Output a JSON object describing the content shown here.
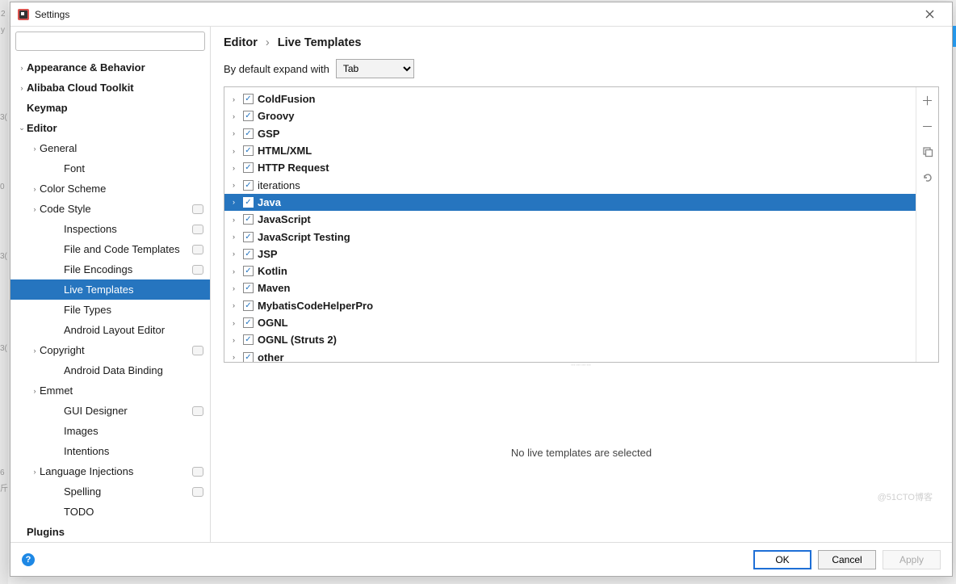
{
  "window": {
    "title": "Settings"
  },
  "search": {
    "placeholder": ""
  },
  "sidebar": [
    {
      "label": "Appearance & Behavior",
      "depth": 0,
      "bold": true,
      "chev": "›"
    },
    {
      "label": "Alibaba Cloud Toolkit",
      "depth": 0,
      "bold": true,
      "chev": "›"
    },
    {
      "label": "Keymap",
      "depth": 0,
      "bold": true
    },
    {
      "label": "Editor",
      "depth": 0,
      "bold": true,
      "chev": "⌄"
    },
    {
      "label": "General",
      "depth": 1,
      "chev": "›"
    },
    {
      "label": "Font",
      "depth": 2
    },
    {
      "label": "Color Scheme",
      "depth": 1,
      "chev": "›"
    },
    {
      "label": "Code Style",
      "depth": 1,
      "chev": "›",
      "pill": true
    },
    {
      "label": "Inspections",
      "depth": 2,
      "pill": true
    },
    {
      "label": "File and Code Templates",
      "depth": 2,
      "pill": true
    },
    {
      "label": "File Encodings",
      "depth": 2,
      "pill": true
    },
    {
      "label": "Live Templates",
      "depth": 2,
      "selected": true
    },
    {
      "label": "File Types",
      "depth": 2
    },
    {
      "label": "Android Layout Editor",
      "depth": 2
    },
    {
      "label": "Copyright",
      "depth": 1,
      "chev": "›",
      "pill": true
    },
    {
      "label": "Android Data Binding",
      "depth": 2
    },
    {
      "label": "Emmet",
      "depth": 1,
      "chev": "›"
    },
    {
      "label": "GUI Designer",
      "depth": 2,
      "pill": true
    },
    {
      "label": "Images",
      "depth": 2
    },
    {
      "label": "Intentions",
      "depth": 2
    },
    {
      "label": "Language Injections",
      "depth": 1,
      "chev": "›",
      "pill": true
    },
    {
      "label": "Spelling",
      "depth": 2,
      "pill": true
    },
    {
      "label": "TODO",
      "depth": 2
    },
    {
      "label": "Plugins",
      "depth": 0,
      "bold": true
    }
  ],
  "breadcrumb": {
    "a": "Editor",
    "b": "Live Templates"
  },
  "expand": {
    "label": "By default expand with",
    "value": "Tab"
  },
  "templates": [
    {
      "label": "ColdFusion",
      "bold": true
    },
    {
      "label": "Groovy",
      "bold": true
    },
    {
      "label": "GSP",
      "bold": true
    },
    {
      "label": "HTML/XML",
      "bold": true
    },
    {
      "label": "HTTP Request",
      "bold": true
    },
    {
      "label": "iterations",
      "bold": false
    },
    {
      "label": "Java",
      "bold": true,
      "selected": true
    },
    {
      "label": "JavaScript",
      "bold": true
    },
    {
      "label": "JavaScript Testing",
      "bold": true
    },
    {
      "label": "JSP",
      "bold": true
    },
    {
      "label": "Kotlin",
      "bold": true
    },
    {
      "label": "Maven",
      "bold": true
    },
    {
      "label": "MybatisCodeHelperPro",
      "bold": true
    },
    {
      "label": "OGNL",
      "bold": true
    },
    {
      "label": "OGNL (Struts 2)",
      "bold": true
    },
    {
      "label": "other",
      "bold": true
    }
  ],
  "empty": "No live templates are selected",
  "buttons": {
    "ok": "OK",
    "cancel": "Cancel",
    "apply": "Apply"
  },
  "watermark": "@51CTO博客"
}
